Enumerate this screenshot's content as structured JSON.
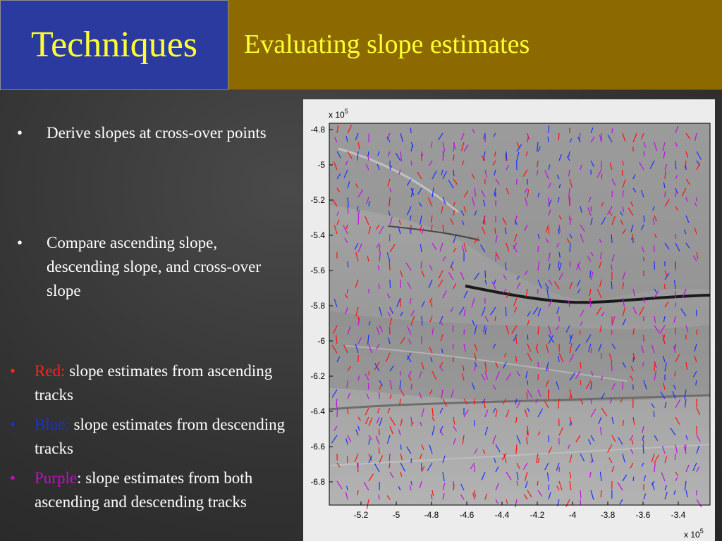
{
  "header": {
    "title": "Techniques",
    "subtitle": "Evaluating slope estimates",
    "title_bg": "#2b3a9e",
    "subtitle_bg": "#8c6a00",
    "text_color": "#ffff33"
  },
  "bullets": [
    {
      "marker": "•",
      "text": "Derive slopes at cross-over points"
    },
    {
      "marker": "•",
      "text": "Compare ascending slope, descending slope, and cross-over slope"
    }
  ],
  "legend": [
    {
      "marker": "•",
      "color_word": "Red:",
      "color": "#ff2020",
      "text": " slope estimates from ascending tracks"
    },
    {
      "marker": "•",
      "color_word": "Blue:",
      "color": "#1a2fd8",
      "text": " slope estimates from descending tracks"
    },
    {
      "marker": "•",
      "color_word": "Purple",
      "color": "#c010c0",
      "text": ": slope estimates from both ascending and descending tracks"
    }
  ],
  "figure": {
    "y_exponent": "x 10",
    "y_exponent_power": "5",
    "x_exponent": "x 10",
    "x_exponent_power": "5",
    "y_ticks": [
      "-4.8",
      "-5",
      "-5.2",
      "-5.4",
      "-5.6",
      "-5.8",
      "-6",
      "-6.2",
      "-6.4",
      "-6.6",
      "-6.8"
    ],
    "x_ticks": [
      "-5.2",
      "-5",
      "-4.8",
      "-4.6",
      "-4.4",
      "-4.2",
      "-4",
      "-3.8",
      "-3.6",
      "-3.4"
    ],
    "background_image": "shaded-relief-ice-surface"
  }
}
